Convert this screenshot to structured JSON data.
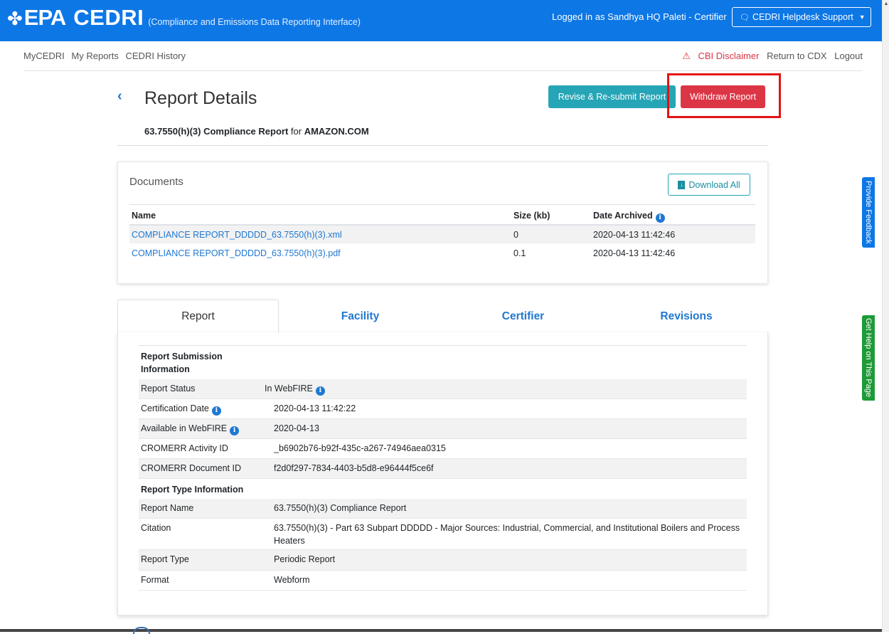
{
  "topbar": {
    "logo_flower": "✤",
    "logo_epa": "EPA",
    "logo_cedri": "CEDRI",
    "logo_sub": "(Compliance and Emissions Data Reporting Interface)",
    "login_text": "Logged in as Sandhya HQ Paleti - Certifier",
    "helpdesk_label": "CEDRI Helpdesk Support",
    "accent_color": "#0d77e6"
  },
  "nav": {
    "left": [
      "MyCEDRI",
      "My Reports",
      "CEDRI History"
    ],
    "cbi": "CBI Disclaimer",
    "return": "Return to CDX",
    "logout": "Logout"
  },
  "header": {
    "title": "Report Details",
    "revise_label": "Revise & Re-submit Report",
    "withdraw_label": "Withdraw Report",
    "subtitle_bold": "63.7550(h)(3) Compliance Report",
    "subtitle_mid": " for ",
    "subtitle_org": "AMAZON.COM"
  },
  "documents": {
    "title": "Documents",
    "download_label": "Download All",
    "columns": [
      "Name",
      "Size (kb)",
      "Date Archived"
    ],
    "rows": [
      {
        "name": "COMPLIANCE REPORT_DDDDD_63.7550(h)(3).xml",
        "size": "0",
        "date": "2020-04-13 11:42:46"
      },
      {
        "name": "COMPLIANCE REPORT_DDDDD_63.7550(h)(3).pdf",
        "size": "0.1",
        "date": "2020-04-13 11:42:46"
      }
    ]
  },
  "tabs": [
    "Report",
    "Facility",
    "Certifier",
    "Revisions"
  ],
  "details": {
    "submission_heading": "Report Submission Information",
    "status_label": "Report Status",
    "status_value": "In WebFIRE",
    "cert_label": "Certification Date",
    "cert_value": "2020-04-13 11:42:22",
    "webfire_label": "Available in WebFIRE",
    "webfire_value": "2020-04-13",
    "activity_label": "CROMERR Activity ID",
    "activity_value": "_b6902b76-b92f-435c-a267-74946aea0315",
    "document_label": "CROMERR Document ID",
    "document_value": "f2d0f297-7834-4403-b5d8-e96444f5ce6f",
    "type_heading": "Report Type Information",
    "name_label": "Report Name",
    "name_value": "63.7550(h)(3) Compliance Report",
    "citation_label": "Citation",
    "citation_value": "63.7550(h)(3) - Part 63 Subpart DDDDD - Major Sources: Industrial, Commercial, and Institutional Boilers and Process Heaters",
    "rtype_label": "Report Type",
    "rtype_value": "Periodic Report",
    "format_label": "Format",
    "format_value": "Webform"
  },
  "side": {
    "feedback": "Provide Feedback",
    "help": "Get Help on This Page"
  }
}
